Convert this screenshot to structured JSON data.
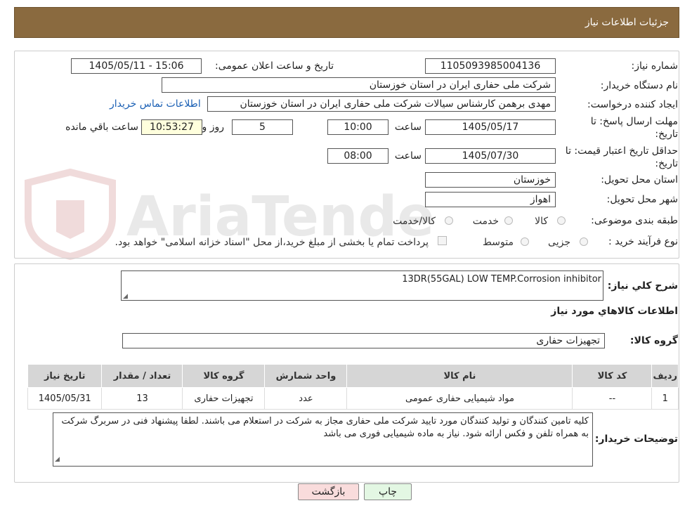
{
  "header": {
    "title": "جزئیات اطلاعات نیاز"
  },
  "fields": {
    "need_number_label": "شماره نیاز:",
    "need_number": "1105093985004136",
    "announce_label": "تاریخ و ساعت اعلان عمومی:",
    "announce_value": "1405/05/11 - 15:06",
    "buyer_org_label": "نام دستگاه خریدار:",
    "buyer_org": "شرکت ملی حفاری ایران در استان خوزستان",
    "creator_label": "ایجاد کننده درخواست:",
    "creator": "مهدی برهمن کارشناس سیالات شرکت ملی حفاری ایران در استان خوزستان",
    "contact_link": "اطلاعات تماس خریدار",
    "deadline_label": "مهلت ارسال پاسخ: تا تاریخ:",
    "deadline_date": "1405/05/17",
    "time_label": "ساعت",
    "deadline_time": "10:00",
    "days_value": "5",
    "days_label": "روز و",
    "remaining_time": "10:53:27",
    "remaining_label": "ساعت باقي مانده",
    "validity_label": "حداقل تاریخ اعتبار قیمت: تا تاریخ:",
    "validity_date": "1405/07/30",
    "validity_time": "08:00",
    "province_label": "استان محل تحویل:",
    "province": "خوزستان",
    "city_label": "شهر محل تحویل:",
    "city": "اهواز",
    "category_label": "طبقه بندی موضوعی:",
    "cat_goods": "کالا",
    "cat_service": "خدمت",
    "cat_goods_service": "کالا/خدمت",
    "process_label": "نوع فرآیند خرید :",
    "proc_partial": "جزیی",
    "proc_medium": "متوسط",
    "payment_note": "پرداخت تمام یا بخشی از مبلغ خرید،از محل \"اسناد خزانه اسلامی\" خواهد بود."
  },
  "need": {
    "desc_label": "شرح کلي نياز:",
    "desc_value": "13DR(55GAL)  LOW TEMP.Corrosion inhibitor",
    "goods_info_title": "اطلاعات کالاهاي مورد نياز",
    "group_label": "گروه کالا:",
    "group_value": "تجهیزات حفاری"
  },
  "table": {
    "headers": [
      "ردیف",
      "کد کالا",
      "نام کالا",
      "واحد شمارش",
      "گروه کالا",
      "تعداد / مقدار",
      "تاریخ نیاز"
    ],
    "rows": [
      [
        "1",
        "--",
        "مواد شیمیایی حفاری عمومی",
        "عدد",
        "تجهیزات حفاری",
        "13",
        "1405/05/31"
      ]
    ]
  },
  "buyer_notes": {
    "label": "توضیحات خریدار:",
    "text": "کلیه تامین کنندگان و تولید کنندگان مورد تایید شرکت ملی حفاری مجاز به شرکت در استعلام می باشند. لطفا پیشنهاد فنی در سربرگ شرکت به همراه تلفن و فکس ارائه شود. نیاز به ماده شیمیایی فوری می باشد"
  },
  "buttons": {
    "print": "چاپ",
    "back": "بازگشت"
  },
  "watermark": "AriaTender.neT",
  "colors": {
    "header_bg": "#8a6a3f",
    "back_btn_bg": "#f9dcdc",
    "print_btn_bg": "#e3f7e3",
    "remaining_bg": "#ffffdd",
    "link": "#1a5fb4"
  }
}
